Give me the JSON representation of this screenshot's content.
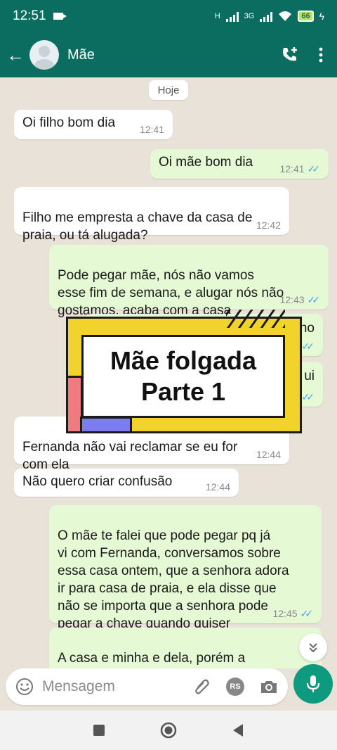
{
  "status_bar": {
    "time": "12:51",
    "network_h": "H",
    "network_3g": "3G",
    "battery": "66"
  },
  "header": {
    "contact_name": "Mãe"
  },
  "chat": {
    "date_chip": "Hoje",
    "messages": [
      {
        "dir": "in",
        "text": "Oi filho bom dia",
        "time": "12:41"
      },
      {
        "dir": "out",
        "text": "Oi mãe bom dia",
        "time": "12:41",
        "ticks": "✓✓"
      },
      {
        "dir": "in",
        "text": "Filho me empresta a chave da casa de\npraia, ou tá alugada?",
        "time": "12:42"
      },
      {
        "dir": "out",
        "text": "Pode pegar mãe, nós não vamos\nesse fim de semana, e alugar nós não\ngostamos, acaba com a casa",
        "time": "12:43",
        "ticks": "✓✓"
      },
      {
        "dir": "in",
        "text": "Fernanda não vai reclamar se eu for\ncom ela",
        "time": "12:44"
      },
      {
        "dir": "in",
        "text": "Não quero criar confusão",
        "time": "12:44"
      },
      {
        "dir": "out",
        "text": "O mãe te falei que pode pegar pq já\nvi com Fernanda, conversamos sobre\nessa casa ontem, que a senhora adora\nir para casa de praia, e ela disse que\nnão se importa que a senhora pode\npegar a chave quando quiser",
        "time": "12:45",
        "ticks": "✓✓"
      },
      {
        "dir": "out",
        "text": "A casa e minha e dela, porém a\nsenhora e a mãe dela pode usar",
        "time": ""
      }
    ],
    "hidden_fragments": {
      "frag1": "no",
      "frag2": "ui"
    }
  },
  "overlay": {
    "line1": "Mãe folgada",
    "line2": "Parte 1"
  },
  "composer": {
    "placeholder": "Mensagem",
    "rs_badge": "RS"
  },
  "colors": {
    "header": "#0b6d5f",
    "outgoing": "#e4f9d4",
    "incoming": "#ffffff",
    "mic": "#0d9a7f",
    "ticks": "#4fa5e8"
  }
}
